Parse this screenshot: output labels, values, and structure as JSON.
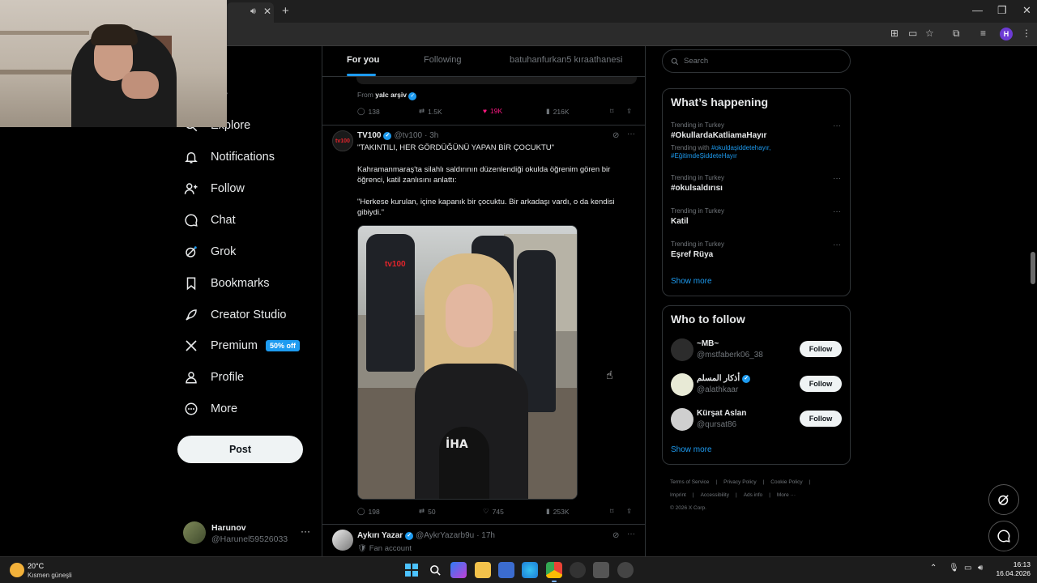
{
  "browser": {
    "tab_audio_icon": "speaker-icon",
    "tab_close": "✕",
    "new_tab": "+",
    "profile_initial": "H"
  },
  "nav": {
    "items": [
      {
        "label": "me",
        "icon": "home-icon"
      },
      {
        "label": "Explore",
        "icon": "search-icon"
      },
      {
        "label": "Notifications",
        "icon": "bell-icon"
      },
      {
        "label": "Follow",
        "icon": "person-add-icon"
      },
      {
        "label": "Chat",
        "icon": "chat-icon"
      },
      {
        "label": "Grok",
        "icon": "grok-icon"
      },
      {
        "label": "Bookmarks",
        "icon": "bookmark-icon"
      },
      {
        "label": "Creator Studio",
        "icon": "rocket-icon"
      },
      {
        "label": "Premium",
        "icon": "x-logo-icon",
        "badge": "50% off"
      },
      {
        "label": "Profile",
        "icon": "person-icon"
      },
      {
        "label": "More",
        "icon": "more-circle-icon"
      }
    ],
    "post_label": "Post",
    "account": {
      "name": "Harunov",
      "handle": "@Harunel59526033",
      "more": "···"
    }
  },
  "feed": {
    "tabs": [
      "For you",
      "Following",
      "batuhanfurkan5 kıraathanesi"
    ],
    "active_tab": "For you",
    "prev_tweet": {
      "from_prefix": "From",
      "from_name": "yalc arşiv",
      "stats": {
        "replies": "138",
        "reposts": "1.5K",
        "likes": "19K",
        "views": "216K"
      }
    },
    "tweet": {
      "name": "TV100",
      "handle": "@tv100",
      "time": "· 3h",
      "avatar_text": "tv100",
      "headline": "\"TAKINTILI, HER GÖRDÜĞÜNÜ YAPAN BİR ÇOCUKTU\"",
      "para1": "Kahramanmaraş'ta silahlı saldırının düzenlendiği okulda öğrenim gören bir öğrenci, katil zanlısını anlattı:",
      "para2": "\"Herkese kurulan, içine kapanık bir çocuktu. Bir arkadaşı vardı, o da kendisi gibiydi.\"",
      "video_watermark": "tv100",
      "mic_logo": "İHA",
      "stats": {
        "replies": "198",
        "reposts": "50",
        "likes": "745",
        "views": "253K"
      }
    },
    "next_tweet": {
      "name": "Aykırı Yazar",
      "handle": "@AykrYazarb9u",
      "time": "· 17h",
      "subtitle": "Fan account"
    }
  },
  "right": {
    "search_placeholder": "Search",
    "whats_happening": {
      "title": "What’s happening",
      "trends": [
        {
          "context": "Trending in Turkey",
          "name": "#OkullardaKatliamaHayır",
          "with_prefix": "Trending with",
          "with_tags": "#okuldaşiddetehayır, #EğitimdeŞiddeteHayır"
        },
        {
          "context": "Trending in Turkey",
          "name": "#okulsaldırısı"
        },
        {
          "context": "Trending in Turkey",
          "name": "Katil"
        },
        {
          "context": "Trending in Turkey",
          "name": "Eşref Rüya"
        }
      ],
      "show_more": "Show more"
    },
    "who_to_follow": {
      "title": "Who to follow",
      "accounts": [
        {
          "name": "~MB~",
          "handle": "@mstfaberk06_38",
          "verified": false
        },
        {
          "name": "أذكار المسلم",
          "handle": "@alathkaar",
          "verified": true
        },
        {
          "name": "Kürşat Aslan",
          "handle": "@qursat86",
          "verified": false
        }
      ],
      "follow_label": "Follow",
      "show_more": "Show more"
    },
    "footer": {
      "links": [
        "Terms of Service",
        "|",
        "Privacy Policy",
        "|",
        "Cookie Policy",
        "|",
        "Imprint",
        "|",
        "Accessibility",
        "|",
        "Ads info",
        "|",
        "More ···"
      ],
      "copyright": "© 2026 X Corp."
    }
  },
  "taskbar": {
    "weather_temp": "20°C",
    "weather_cond": "Kısmen güneşli",
    "time": "16:13",
    "date": "16.04.2026"
  },
  "colors": {
    "accent": "#1d9bf0",
    "like": "#f91880",
    "border": "#2f3336",
    "muted": "#71767b"
  }
}
